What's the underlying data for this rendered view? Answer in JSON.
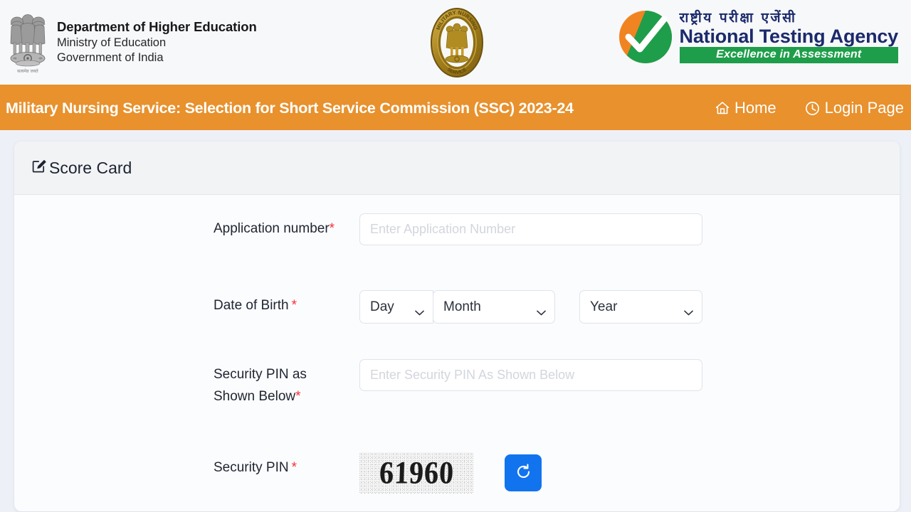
{
  "header": {
    "gov_line1": "Department of Higher Education",
    "gov_line2": "Ministry of Education",
    "gov_line3": "Government of India",
    "emblem_icon": "ashoka-lion-capital-emblem",
    "center_emblem_icon": "military-nursing-service-badge",
    "nta_hindi": "राष्ट्रीय परीक्षा एजेंसी",
    "nta_english": "National Testing Agency",
    "nta_tagline": "Excellence in Assessment",
    "nta_logo_icon": "nta-checkmark-circle-logo",
    "nta_orange": "#f08421",
    "nta_green": "#1e9e4a",
    "nta_navy": "#1b2a6b"
  },
  "banner": {
    "title": "Military Nursing Service: Selection for Short Service Commission (SSC) 2023-24",
    "background_color": "#e8912d",
    "nav": [
      {
        "label": "Home",
        "icon": "home-icon"
      },
      {
        "label": "Login Page",
        "icon": "clock-icon"
      }
    ]
  },
  "card": {
    "title": "Score Card",
    "title_icon": "edit-square-icon"
  },
  "form": {
    "application_number": {
      "label": "Application number",
      "required_marker": "*",
      "placeholder": "Enter Application Number",
      "value": ""
    },
    "date_of_birth": {
      "label": "Date of Birth",
      "required_marker": "*",
      "day": {
        "selected": "Day"
      },
      "month": {
        "selected": "Month"
      },
      "year": {
        "selected": "Year"
      },
      "chevron_icon": "chevron-down-icon"
    },
    "security_pin_input": {
      "label_line1": "Security PIN as",
      "label_line2": "Shown Below",
      "required_marker": "*",
      "placeholder": "Enter Security PIN As Shown Below",
      "value": ""
    },
    "security_pin_captcha": {
      "label": "Security PIN",
      "required_marker": "*",
      "captcha_value": "61960",
      "refresh_icon": "refresh-icon",
      "refresh_button_color": "#1273ef"
    }
  }
}
